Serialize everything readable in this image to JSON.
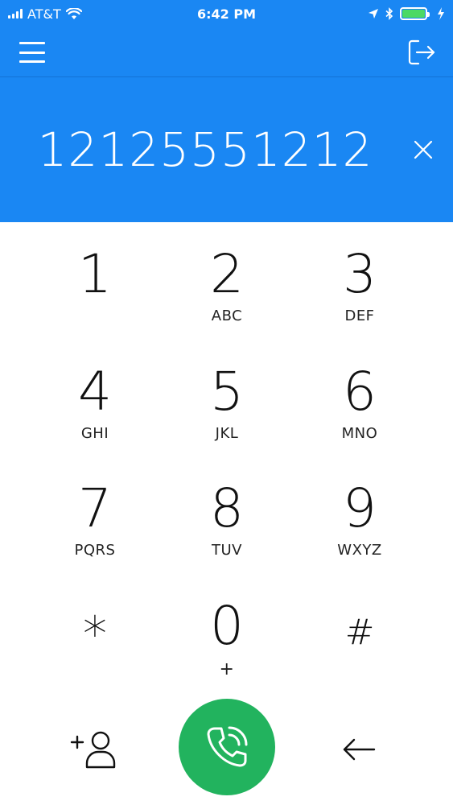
{
  "status_bar": {
    "carrier": "AT&T",
    "time": "6:42 PM"
  },
  "dialer": {
    "number": "12125551212"
  },
  "keypad": {
    "keys": [
      {
        "digit": "1",
        "letters": ""
      },
      {
        "digit": "2",
        "letters": "ABC"
      },
      {
        "digit": "3",
        "letters": "DEF"
      },
      {
        "digit": "4",
        "letters": "GHI"
      },
      {
        "digit": "5",
        "letters": "JKL"
      },
      {
        "digit": "6",
        "letters": "MNO"
      },
      {
        "digit": "7",
        "letters": "PQRS"
      },
      {
        "digit": "8",
        "letters": "TUV"
      },
      {
        "digit": "9",
        "letters": "WXYZ"
      },
      {
        "digit": "*",
        "letters": ""
      },
      {
        "digit": "0",
        "letters": "+"
      },
      {
        "digit": "#",
        "letters": ""
      }
    ]
  },
  "colors": {
    "header_blue": "#1a87f3",
    "call_green": "#22b35e",
    "battery_green": "#4cd964"
  },
  "icons": {
    "menu": "hamburger-menu-icon",
    "logout": "logout-icon",
    "clear": "close-icon",
    "add_contact": "add-contact-icon",
    "call": "phone-icon",
    "backspace": "arrow-left-icon"
  }
}
